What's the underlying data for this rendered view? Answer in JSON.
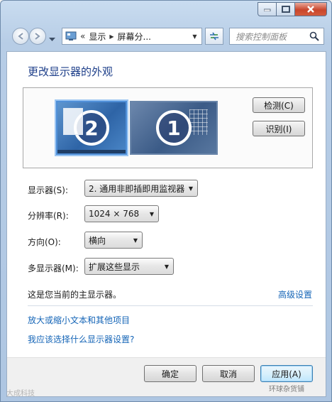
{
  "window": {
    "caption_buttons": [
      "minimize-icon",
      "maximize-icon",
      "close-icon"
    ]
  },
  "nav": {
    "breadcrumb": [
      "显示",
      "屏幕分..."
    ],
    "search_placeholder": "搜索控制面板"
  },
  "page": {
    "title": "更改显示器的外观",
    "monitors": [
      {
        "number": "2",
        "selected": true
      },
      {
        "number": "1",
        "selected": false
      }
    ],
    "detect_button": "检测(C)",
    "identify_button": "识别(I)",
    "fields": {
      "display_label": "显示器(S):",
      "display_value": "2. 通用非即插即用监视器",
      "resolution_label": "分辨率(R):",
      "resolution_value": "1024 × 768",
      "orientation_label": "方向(O):",
      "orientation_value": "横向",
      "multi_label": "多显示器(M):",
      "multi_value": "扩展这些显示"
    },
    "primary_note": "这是您当前的主显示器。",
    "advanced_link": "高级设置",
    "link_text_size": "放大或缩小文本和其他项目",
    "link_help": "我应该选择什么显示器设置?"
  },
  "footer": {
    "ok": "确定",
    "cancel": "取消",
    "apply": "应用(A)"
  },
  "watermarks": {
    "left": "大成科技",
    "right": "环球杂货铺"
  },
  "colors": {
    "title_blue": "#1e3f8a",
    "link_blue": "#1565b7",
    "selected_monitor": "#2e64a6",
    "close_red": "#c9462c"
  }
}
